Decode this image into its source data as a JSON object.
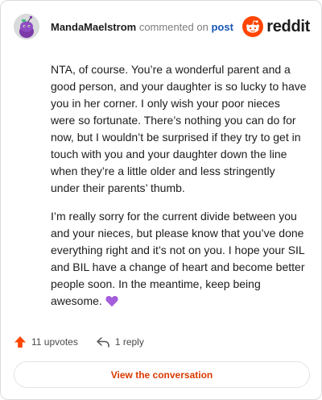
{
  "comment": {
    "author": "MandaMaelstrom",
    "action_text": "commented on",
    "post_link": "post",
    "paragraphs": [
      "NTA, of course. You’re a wonderful parent and a good person, and your daughter is so lucky to have you in her corner. I only wish your poor nieces were so fortunate. There’s nothing you can do for now, but I wouldn’t be surprised if they try to get in touch with you and your daughter down the line when they’re a little older and less stringently under their parents’ thumb.",
      "I’m really sorry for the current divide between you and your nieces, but please know that you’ve done everything right and it’s not on you. I hope your SIL and BIL have a change of heart and become better people soon. In the meantime, keep being awesome."
    ],
    "upvotes": "11 upvotes",
    "replies": "1 reply"
  },
  "brand": {
    "name": "reddit",
    "color": "#ff4500"
  },
  "cta": {
    "label": "View the conversation"
  },
  "icons": {
    "avatar": "snoo-avatar-icon",
    "brand": "reddit-logo-icon",
    "heart": "purple-heart-emoji",
    "upvote": "upvote-arrow-icon",
    "reply": "reply-arrow-icon"
  },
  "colors": {
    "accent": "#d93a00",
    "link": "#1a57b6",
    "upvote": "#ff4500",
    "heart": "#a45ddb"
  }
}
